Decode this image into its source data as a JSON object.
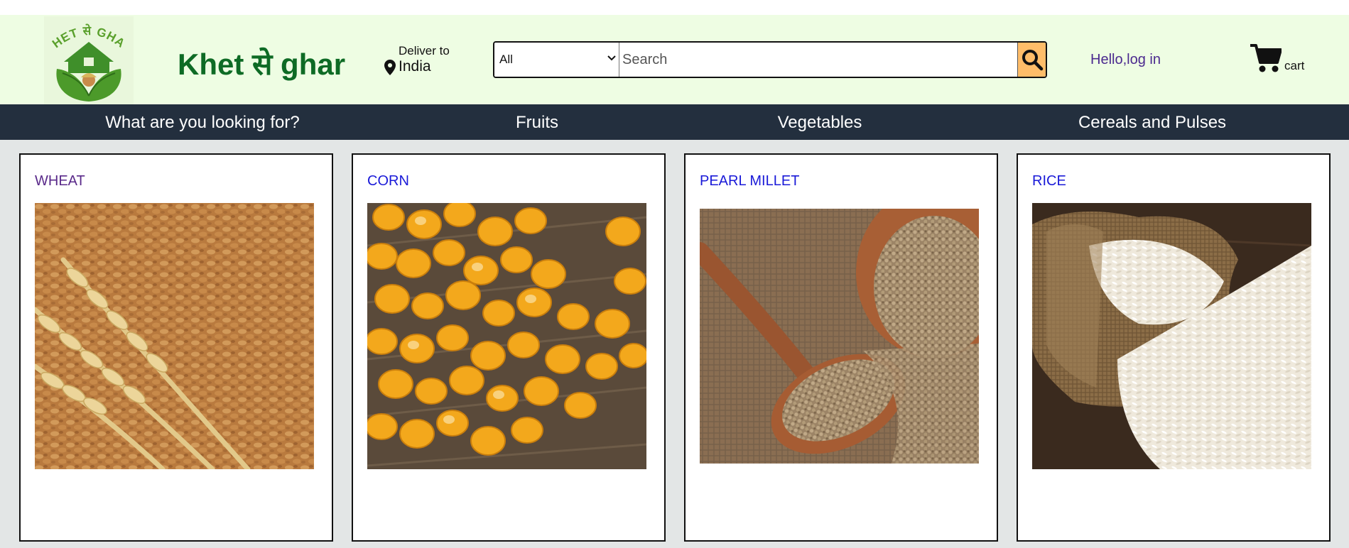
{
  "stray_char": "`",
  "header": {
    "brand": "Khet से ghar",
    "logo_text": "KHET से GHAR",
    "deliver_label": "Deliver to",
    "deliver_location": "India",
    "search": {
      "category": "All",
      "placeholder": "Search"
    },
    "login_text": "Hello,log in",
    "cart_label": "cart"
  },
  "nav": {
    "items": [
      "What are you looking for?",
      "Fruits",
      "Vegetables",
      "Cereals and Pulses"
    ]
  },
  "products": [
    {
      "name": "WHEAT",
      "image": "wheat-grains-photo",
      "title_color": "#5a2a8a"
    },
    {
      "name": "CORN",
      "image": "corn-kernels-photo",
      "title_color": "#1a1ad8"
    },
    {
      "name": "PEARL MILLET",
      "image": "pearl-millet-photo",
      "title_color": "#1a1ad8"
    },
    {
      "name": "RICE",
      "image": "rice-sack-photo",
      "title_color": "#1a1ad8"
    }
  ],
  "colors": {
    "header_bg": "#eefde3",
    "nav_bg": "#232f3e",
    "search_button": "#febd69",
    "brand_green": "#0e6b25",
    "page_bg": "#e3e6e6"
  }
}
